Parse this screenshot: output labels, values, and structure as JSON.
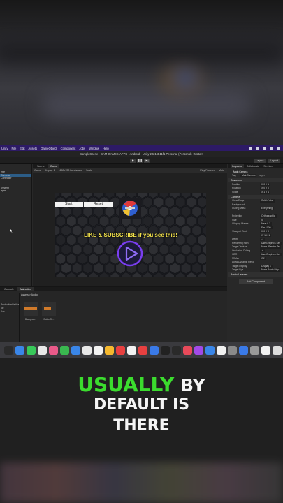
{
  "menubar": {
    "items": [
      "Unity",
      "File",
      "Edit",
      "Assets",
      "GameObject",
      "Component",
      "Jobs",
      "Window",
      "Help"
    ]
  },
  "window": {
    "title": "SampleScene - BAM-GAMES-APPS - Android - Unity 2021.3.11f1 Personal (Personal) <Metal>"
  },
  "toolbar": {
    "play": "▶",
    "pause": "❚❚",
    "step": "▶|",
    "layers": "Layers",
    "layout": "Layout"
  },
  "hierarchy": {
    "rows": [
      "",
      "",
      "ene",
      "Camera",
      "Controller",
      "",
      "",
      "System",
      "ager"
    ]
  },
  "scene": {
    "tabs": [
      "Scene",
      "Game"
    ],
    "game_bar": [
      "Game",
      "Display 1",
      "1280x720 Landscape",
      "Scale",
      "Play Focused",
      "Mute"
    ],
    "start_label": "Start",
    "reset_label": "Reset",
    "subscribe_text": "LIKE & SUBSCRIBE if you see this!"
  },
  "inspector": {
    "tabs": [
      "Inspector",
      "Collaborate",
      "Services"
    ],
    "object_name": "Main Camera",
    "tag_label": "Tag",
    "tag_value": "MainCamera",
    "layer_label": "Layer",
    "transform_header": "Transform",
    "transform_rows": [
      {
        "k": "Position",
        "v": "X 0  Y 1"
      },
      {
        "k": "Rotation",
        "v": "X 0  Y 0"
      },
      {
        "k": "Scale",
        "v": "X 1  Y 1"
      }
    ],
    "camera_header": "Camera",
    "camera_rows": [
      {
        "k": "Clear Flags",
        "v": "Solid Color"
      },
      {
        "k": "Background",
        "v": ""
      },
      {
        "k": "Culling Mask",
        "v": "Everything"
      },
      {
        "k": "",
        "v": ""
      },
      {
        "k": "Projection",
        "v": "Orthographic"
      },
      {
        "k": "Size",
        "v": "5"
      },
      {
        "k": "Clipping Planes",
        "v": "Near 0.3"
      },
      {
        "k": "",
        "v": "Far 1000"
      },
      {
        "k": "Viewport Rect",
        "v": "X 0  Y 0"
      },
      {
        "k": "",
        "v": "W 1  H 1"
      },
      {
        "k": "Depth",
        "v": "-1"
      },
      {
        "k": "Rendering Path",
        "v": "Use Graphics Set"
      },
      {
        "k": "Target Texture",
        "v": "None (Render Te"
      },
      {
        "k": "Occlusion Culling",
        "v": "✓"
      },
      {
        "k": "HDR",
        "v": "Use Graphics Set"
      },
      {
        "k": "MSAA",
        "v": "Off"
      },
      {
        "k": "Allow Dynamic Resol",
        "v": ""
      },
      {
        "k": "Target Display",
        "v": "Display 1"
      },
      {
        "k": "Target Eye",
        "v": "None (Main Disp"
      }
    ],
    "audio_header": "Audio Listener",
    "add_component": "Add Component"
  },
  "project": {
    "tabs": [
      "Console",
      "Animation"
    ],
    "left_rows": [
      "",
      "",
      "",
      "ProductionListMan",
      "ule",
      "Ads",
      ""
    ],
    "breadcrumb": "Assets > Audio",
    "assets": [
      "Backgrou...",
      "ButtonSt..."
    ]
  },
  "caption": {
    "highlight": "USUALLY",
    "line1_rest": "BY",
    "line2": "DEFAULT IS",
    "line3": "THERE"
  },
  "colors": {
    "menubar": "#2d1a66",
    "highlight": "#3bdc2e",
    "subscribe": "#f2e14a",
    "selection": "#2c5d87"
  }
}
